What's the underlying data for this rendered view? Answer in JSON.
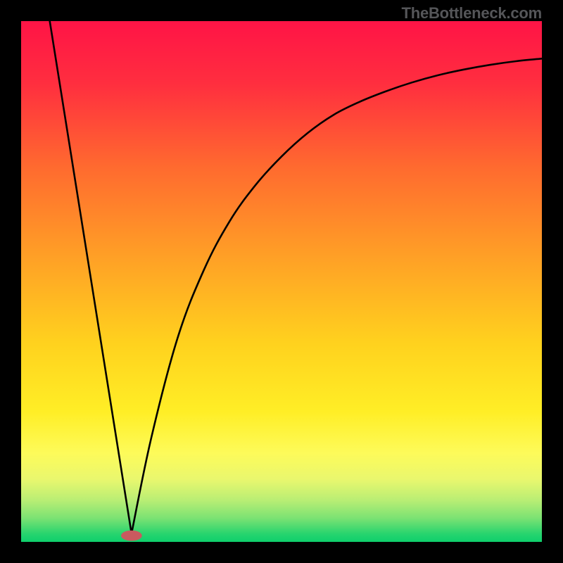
{
  "watermark": "TheBottleneck.com",
  "chart_data": {
    "type": "line",
    "title": "",
    "xlabel": "",
    "ylabel": "",
    "xlim": [
      0,
      1
    ],
    "ylim": [
      0,
      1
    ],
    "description": "Bottleneck-style curve: a sharp V with minimum near x≈0.21, rising toward an asymptote on the right, over a vertical red→yellow→green gradient background framed in black.",
    "gradient_stops": [
      {
        "offset": 0.0,
        "color": "#ff1446"
      },
      {
        "offset": 0.12,
        "color": "#ff2e3f"
      },
      {
        "offset": 0.28,
        "color": "#ff6a2f"
      },
      {
        "offset": 0.45,
        "color": "#ff9f26"
      },
      {
        "offset": 0.62,
        "color": "#ffd21e"
      },
      {
        "offset": 0.75,
        "color": "#ffee26"
      },
      {
        "offset": 0.83,
        "color": "#fdfb5a"
      },
      {
        "offset": 0.88,
        "color": "#e9f76e"
      },
      {
        "offset": 0.92,
        "color": "#b9ee74"
      },
      {
        "offset": 0.955,
        "color": "#7ae273"
      },
      {
        "offset": 0.985,
        "color": "#26d46e"
      },
      {
        "offset": 1.0,
        "color": "#0fcf6c"
      }
    ],
    "curve": {
      "min_x": 0.212,
      "min_y": 0.016,
      "left_branch": [
        {
          "x": 0.055,
          "y": 1.0
        },
        {
          "x": 0.212,
          "y": 0.016
        }
      ],
      "right_branch": [
        {
          "x": 0.212,
          "y": 0.016
        },
        {
          "x": 0.25,
          "y": 0.2
        },
        {
          "x": 0.3,
          "y": 0.39
        },
        {
          "x": 0.35,
          "y": 0.52
        },
        {
          "x": 0.4,
          "y": 0.615
        },
        {
          "x": 0.45,
          "y": 0.685
        },
        {
          "x": 0.5,
          "y": 0.74
        },
        {
          "x": 0.55,
          "y": 0.785
        },
        {
          "x": 0.6,
          "y": 0.82
        },
        {
          "x": 0.65,
          "y": 0.845
        },
        {
          "x": 0.7,
          "y": 0.865
        },
        {
          "x": 0.75,
          "y": 0.882
        },
        {
          "x": 0.8,
          "y": 0.896
        },
        {
          "x": 0.85,
          "y": 0.907
        },
        {
          "x": 0.9,
          "y": 0.916
        },
        {
          "x": 0.95,
          "y": 0.923
        },
        {
          "x": 1.0,
          "y": 0.928
        }
      ]
    },
    "marker": {
      "cx": 0.212,
      "cy": 0.012,
      "rx": 0.02,
      "ry": 0.01,
      "fill": "#c95a5f"
    }
  }
}
